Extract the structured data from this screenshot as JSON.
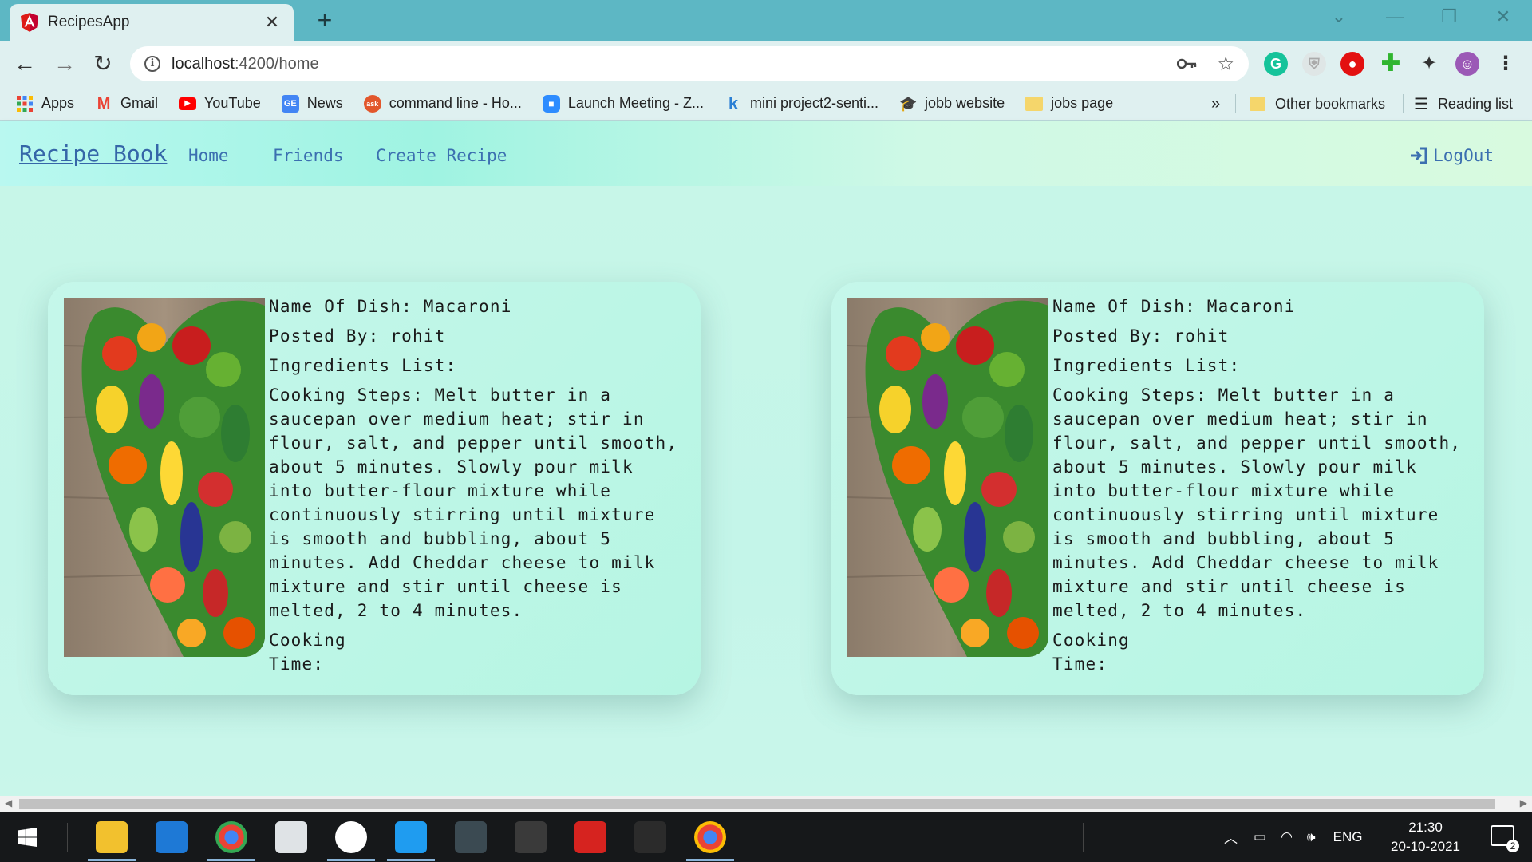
{
  "browser": {
    "tab_title": "RecipesApp",
    "tab_close": "✕",
    "new_tab": "+",
    "url_host": "localhost",
    "url_path": ":4200/home",
    "bookmarks": [
      {
        "label": "Apps",
        "icon": "apps-grid-icon"
      },
      {
        "label": "Gmail",
        "icon": "gmail-icon"
      },
      {
        "label": "YouTube",
        "icon": "youtube-icon"
      },
      {
        "label": "News",
        "icon": "google-news-icon"
      },
      {
        "label": "command line - Ho...",
        "icon": "ask-icon"
      },
      {
        "label": "Launch Meeting - Z...",
        "icon": "zoom-icon"
      },
      {
        "label": "mini project2-senti...",
        "icon": "k-icon"
      },
      {
        "label": "jobb website",
        "icon": "graduation-cap-icon"
      },
      {
        "label": "jobs page",
        "icon": "folder-icon"
      }
    ],
    "more_bookmarks": "»",
    "other_bookmarks": "Other bookmarks",
    "reading_list": "Reading list"
  },
  "app": {
    "brand": "Recipe Book",
    "nav": [
      "Home",
      "Friends",
      "Create Recipe"
    ],
    "logout": "LogOut"
  },
  "recipes": [
    {
      "name": "Name Of Dish: Macaroni",
      "posted_by": "Posted By: rohit",
      "ingredients": "Ingredients List:",
      "steps": "Cooking Steps: Melt butter in a saucepan over medium heat; stir in flour, salt, and pepper until smooth, about 5 minutes. Slowly pour milk into butter-flour mixture while continuously stirring until mixture is smooth and bubbling, about 5 minutes. Add Cheddar cheese to milk mixture and stir until cheese is melted, 2 to 4 minutes.",
      "time": "Cooking Time:"
    },
    {
      "name": "Name Of Dish: Macaroni",
      "posted_by": "Posted By: rohit",
      "ingredients": "Ingredients List:",
      "steps": "Cooking Steps: Melt butter in a saucepan over medium heat; stir in flour, salt, and pepper until smooth, about 5 minutes. Slowly pour milk into butter-flour mixture while continuously stirring until mixture is smooth and bubbling, about 5 minutes. Add Cheddar cheese to milk mixture and stir until cheese is melted, 2 to 4 minutes.",
      "time": "Cooking Time:"
    }
  ],
  "taskbar": {
    "language": "ENG",
    "time": "21:30",
    "date": "20-10-2021",
    "notifications": "2"
  },
  "colors": {
    "tab_bar": "#5db7c4",
    "link": "#3b6fb0",
    "card_bg": "#c5f7ea"
  }
}
